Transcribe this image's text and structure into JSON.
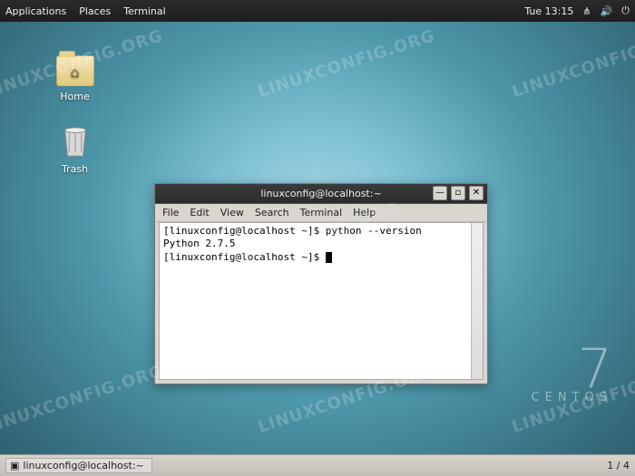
{
  "topbar": {
    "apps": "Applications",
    "places": "Places",
    "terminal": "Terminal",
    "clock": "Tue 13:15",
    "net_icon": "network-icon",
    "vol_icon": "volume-icon",
    "power_icon": "power-icon"
  },
  "desktop_icons": {
    "home": "Home",
    "trash": "Trash"
  },
  "window": {
    "title": "linuxconfig@localhost:~",
    "menu": {
      "file": "File",
      "edit": "Edit",
      "view": "View",
      "search": "Search",
      "terminal": "Terminal",
      "help": "Help"
    },
    "controls": {
      "min": "—",
      "max": "▫",
      "close": "✕"
    },
    "terminal": {
      "line1": "[linuxconfig@localhost ~]$ python --version",
      "line2": "Python 2.7.5",
      "line3": "[linuxconfig@localhost ~]$ "
    }
  },
  "brand": {
    "seven": "7",
    "name": "CENTOS"
  },
  "taskbar": {
    "item": "linuxconfig@localhost:~",
    "workspaces": "1 / 4"
  },
  "watermark": "LINUXCONFIG.ORG"
}
